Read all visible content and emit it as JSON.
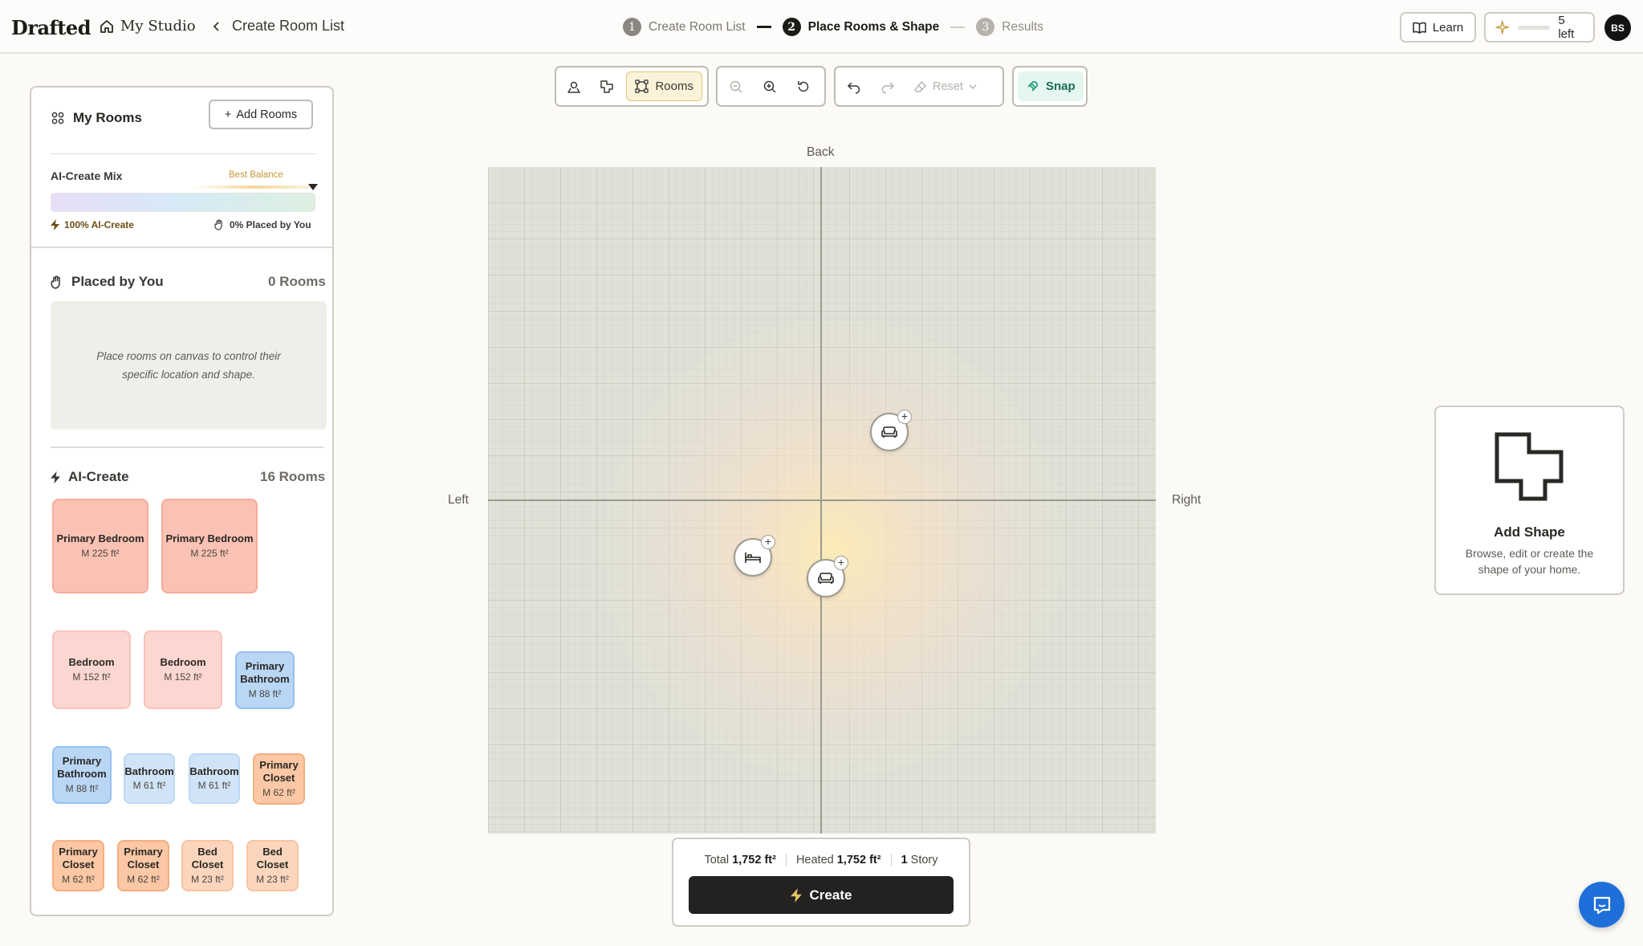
{
  "header": {
    "logo": "Drafted",
    "studio": "My Studio",
    "back_label": "Create Room List",
    "steps": [
      {
        "num": "1",
        "label": "Create Room List"
      },
      {
        "num": "2",
        "label": "Place Rooms & Shape"
      },
      {
        "num": "3",
        "label": "Results"
      }
    ],
    "learn": "Learn",
    "credits": "5 left",
    "avatar": "BS"
  },
  "panel": {
    "title": "My Rooms",
    "add_rooms": "Add Rooms",
    "mix_label": "AI-Create Mix",
    "mix_badge": "Best Balance",
    "mix_left": "100% AI-Create",
    "mix_right": "0% Placed by You",
    "placed_title": "Placed by You",
    "placed_count": "0 Rooms",
    "placed_hint": "Place rooms on canvas to control their specific location and shape.",
    "ai_title": "AI-Create",
    "ai_count": "16 Rooms",
    "rooms": [
      {
        "name": "Primary Bedroom",
        "size": "M 225 ft²"
      },
      {
        "name": "Primary Bedroom",
        "size": "M 225 ft²"
      },
      {
        "name": "Bedroom",
        "size": "M 152 ft²"
      },
      {
        "name": "Bedroom",
        "size": "M 152 ft²"
      },
      {
        "name": "Primary Bathroom",
        "size": "M 88 ft²"
      },
      {
        "name": "Primary Bathroom",
        "size": "M 88 ft²"
      },
      {
        "name": "Bathroom",
        "size": "M 61 ft²"
      },
      {
        "name": "Bathroom",
        "size": "M 61 ft²"
      },
      {
        "name": "Primary Closet",
        "size": "M 62 ft²"
      },
      {
        "name": "Primary Closet",
        "size": "M 62 ft²"
      },
      {
        "name": "Primary Closet",
        "size": "M 62 ft²"
      },
      {
        "name": "Bed Closet",
        "size": "M 23 ft²"
      },
      {
        "name": "Bed Closet",
        "size": "M 23 ft²"
      }
    ]
  },
  "toolbar": {
    "rooms": "Rooms",
    "reset": "Reset",
    "snap": "Snap"
  },
  "canvas": {
    "back": "Back",
    "left": "Left",
    "right": "Right",
    "markers": [
      {
        "icon": "sofa-icon"
      },
      {
        "icon": "bed-icon"
      },
      {
        "icon": "sofa-icon"
      }
    ]
  },
  "summary": {
    "total_label": "Total",
    "total_value": "1,752 ft²",
    "heated_label": "Heated",
    "heated_value": "1,752 ft²",
    "stories_value": "1",
    "stories_label": "Story",
    "create": "Create"
  },
  "shape_card": {
    "title": "Add Shape",
    "description": "Browse, edit or create the shape of your home."
  },
  "colors": {
    "primary_bedroom": "#fac2b4",
    "bedroom": "#fcd6d0",
    "primary_bathroom": "#b9d6f5",
    "bathroom": "#d1e4f7",
    "primary_closet": "#fbc7a4",
    "bed_closet": "#fbd6bd",
    "snap_accent": "#1d6b54",
    "chat": "#1e6fd9"
  }
}
